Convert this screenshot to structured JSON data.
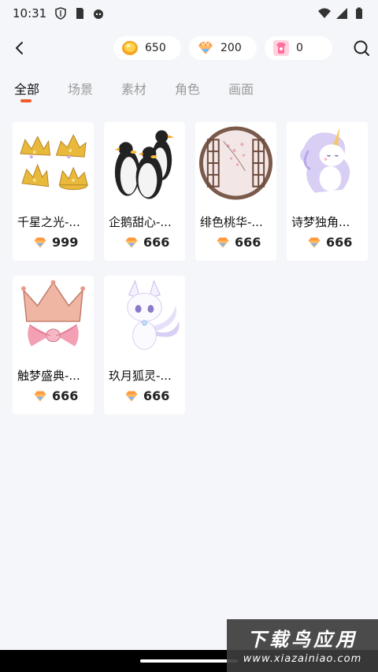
{
  "status_bar": {
    "time": "10:31"
  },
  "header": {
    "currencies": [
      {
        "icon": "gold-coin-icon",
        "value": "650"
      },
      {
        "icon": "diamond-gem-icon",
        "value": "200"
      },
      {
        "icon": "shirt-ticket-icon",
        "value": "0"
      }
    ]
  },
  "tabs": [
    {
      "label": "全部",
      "active": true
    },
    {
      "label": "场景",
      "active": false
    },
    {
      "label": "素材",
      "active": false
    },
    {
      "label": "角色",
      "active": false
    },
    {
      "label": "画面",
      "active": false
    }
  ],
  "items": [
    {
      "name": "千星之光-...",
      "price": "999",
      "art": "crowns"
    },
    {
      "name": "企鹅甜心-...",
      "price": "666",
      "art": "penguins"
    },
    {
      "name": "绯色桃华-...",
      "price": "666",
      "art": "window"
    },
    {
      "name": "诗梦独角...",
      "price": "666",
      "art": "unicorn"
    },
    {
      "name": "触梦盛典-...",
      "price": "666",
      "art": "bow-crown"
    },
    {
      "name": "玖月狐灵-...",
      "price": "666",
      "art": "fox"
    }
  ],
  "watermark": {
    "title": "下载鸟应用",
    "url": "www.xiazainiao.com"
  },
  "colors": {
    "accent": "#f05a2a",
    "background": "#f5f6fa"
  }
}
